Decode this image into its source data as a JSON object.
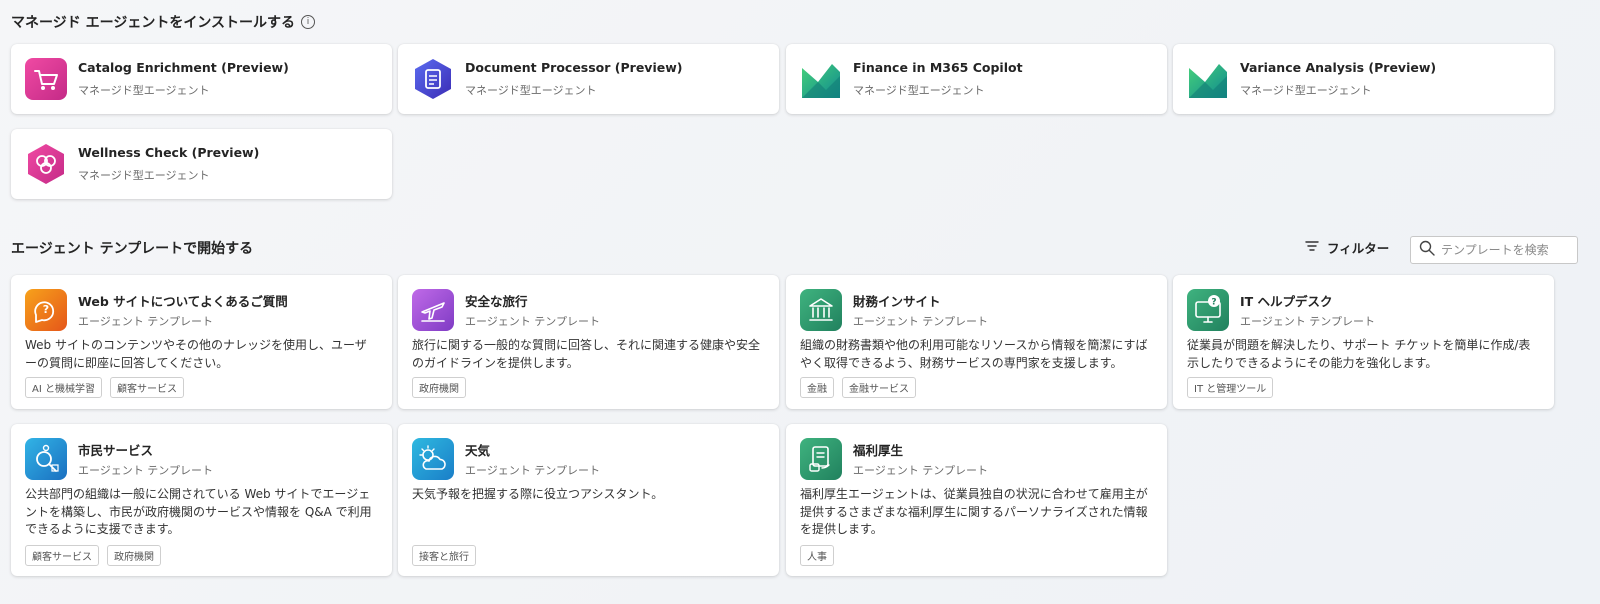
{
  "managed_section": {
    "title": "マネージド エージェントをインストールする",
    "info_icon": "info-icon",
    "cards": [
      {
        "title": "Catalog Enrichment (Preview)",
        "subtitle": "マネージド型エージェント",
        "icon": "cart-icon",
        "color": "#e2318c"
      },
      {
        "title": "Document Processor (Preview)",
        "subtitle": "マネージド型エージェント",
        "icon": "document-processor-icon",
        "color": "#4c3fd1"
      },
      {
        "title": "Finance in M365 Copilot",
        "subtitle": "マネージド型エージェント",
        "icon": "finance-m365-icon",
        "color": "#1fa86e"
      },
      {
        "title": "Variance Analysis (Preview)",
        "subtitle": "マネージド型エージェント",
        "icon": "variance-analysis-icon",
        "color": "#1fa86e"
      },
      {
        "title": "Wellness Check (Preview)",
        "subtitle": "マネージド型エージェント",
        "icon": "wellness-icon",
        "color": "#e2318c"
      }
    ]
  },
  "template_section": {
    "title": "エージェント テンプレートで開始する",
    "filter_label": "フィルター",
    "search_placeholder": "テンプレートを検索",
    "cards": [
      {
        "title": "Web サイトについてよくあるご質問",
        "subtitle": "エージェント テンプレート",
        "description": "Web サイトのコンテンツやその他のナレッジを使用し、ユーザーの質問に即座に回答してください。",
        "tags": [
          "AI と機械学習",
          "顧客サービス"
        ],
        "icon": "faq-chat-icon",
        "color": "#f07a1a"
      },
      {
        "title": "安全な旅行",
        "subtitle": "エージェント テンプレート",
        "description": "旅行に関する一般的な質問に回答し、それに関連する健康や安全のガイドラインを提供します。",
        "tags": [
          "政府機関"
        ],
        "icon": "airplane-icon",
        "color": "#9b4fd6"
      },
      {
        "title": "財務インサイト",
        "subtitle": "エージェント テンプレート",
        "description": "組織の財務書類や他の利用可能なリソースから情報を簡潔にすばやく取得できるよう、財務サービスの専門家を支援します。",
        "tags": [
          "金融",
          "金融サービス"
        ],
        "icon": "bank-icon",
        "color": "#2f9a6e"
      },
      {
        "title": "IT ヘルプデスク",
        "subtitle": "エージェント テンプレート",
        "description": "従業員が問題を解決したり、サポート チケットを簡単に作成/表示したりできるようにその能力を強化します。",
        "tags": [
          "IT と管理ツール"
        ],
        "icon": "help-monitor-icon",
        "color": "#2f9a6e"
      },
      {
        "title": "市民サービス",
        "subtitle": "エージェント テンプレート",
        "description": "公共部門の組織は一般に公開されている Web サイトでエージェントを構築し、市民が政府機関のサービスや情報を Q&A で利用できるように支援できます。",
        "tags": [
          "顧客サービス",
          "政府機関"
        ],
        "icon": "citizen-search-icon",
        "color": "#1f8fd0"
      },
      {
        "title": "天気",
        "subtitle": "エージェント テンプレート",
        "description": "天気予報を把握する際に役立つアシスタント。",
        "tags": [
          "接客と旅行"
        ],
        "icon": "weather-icon",
        "color": "#1f9ad0"
      },
      {
        "title": "福利厚生",
        "subtitle": "エージェント テンプレート",
        "description": "福利厚生エージェントは、従業員独自の状況に合わせて雇用主が提供するさまざまな福利厚生に関するパーソナライズされた情報を提供します。",
        "tags": [
          "人事"
        ],
        "icon": "benefits-icon",
        "color": "#2f9a6e"
      }
    ]
  }
}
